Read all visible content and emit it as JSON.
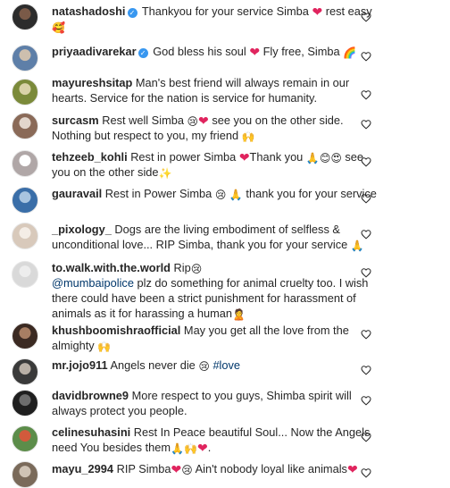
{
  "comments": [
    {
      "user": "natashadoshi",
      "verified": true,
      "segments": [
        {
          "t": "Thankyou for your service Simba "
        },
        {
          "e": "❤",
          "c": "heart"
        },
        {
          "t": " rest easy "
        },
        {
          "e": "🥰"
        }
      ],
      "avatar_colors": [
        "#2c2c2c",
        "#7a5a48"
      ]
    },
    {
      "user": "priyaadivarekar",
      "verified": true,
      "segments": [
        {
          "t": "God bless his soul "
        },
        {
          "e": "❤",
          "c": "heart"
        },
        {
          "t": " Fly free, Simba "
        },
        {
          "e": "🌈"
        }
      ],
      "avatar_colors": [
        "#5e7fa8",
        "#cdbfae"
      ]
    },
    {
      "user": "mayureshsitap",
      "verified": false,
      "segments": [
        {
          "t": "Man's best friend will always remain in our hearts. Service for the nation is service for humanity."
        }
      ],
      "avatar_colors": [
        "#7b8a3a",
        "#d9d2a8"
      ]
    },
    {
      "user": "surcasm",
      "verified": false,
      "segments": [
        {
          "t": "Rest well Simba "
        },
        {
          "e": "😢"
        },
        {
          "e": "❤",
          "c": "heart"
        },
        {
          "t": " see you on the other side. Nothing but respect to you, my friend "
        },
        {
          "e": "🙌"
        }
      ],
      "avatar_colors": [
        "#8a6a58",
        "#e2d6cc"
      ]
    },
    {
      "user": "tehzeeb_kohli",
      "verified": false,
      "segments": [
        {
          "t": "Rest in power Simba "
        },
        {
          "e": "❤",
          "c": "heart"
        },
        {
          "t": "Thank you "
        },
        {
          "e": "🙏"
        },
        {
          "e": "😊"
        },
        {
          "e": "😍"
        },
        {
          "t": " see you on the other side"
        },
        {
          "e": "✨"
        }
      ],
      "avatar_colors": [
        "#b0a7a7",
        "#ffffff"
      ]
    },
    {
      "user": "gauravail",
      "verified": false,
      "segments": [
        {
          "t": "Rest in Power Simba "
        },
        {
          "e": "😢"
        },
        {
          "t": " "
        },
        {
          "e": "🙏"
        },
        {
          "t": " thank you for your service"
        }
      ],
      "avatar_colors": [
        "#3a6ea8",
        "#a8c4e0"
      ]
    },
    {
      "user": "_pixology_",
      "verified": false,
      "segments": [
        {
          "t": "Dogs are the living embodiment of selfless & unconditional love... RIP Simba, thank you for your service "
        },
        {
          "e": "🙏"
        }
      ],
      "avatar_colors": [
        "#d8c9bb",
        "#f4ede6"
      ]
    },
    {
      "user": "to.walk.with.the.world",
      "verified": false,
      "segments": [
        {
          "t": "Rip"
        },
        {
          "e": "😢"
        },
        {
          "br": true
        },
        {
          "m": "@mumbaipolice"
        },
        {
          "t": " plz do something for animal cruelty too. I wish there could have been a strict punishment for harassment of animals as it for harassing a human"
        },
        {
          "e": "🙎"
        }
      ],
      "avatar_colors": [
        "#d9d9d9",
        "#ededed"
      ]
    },
    {
      "user": "khushboomishraofficial",
      "verified": false,
      "segments": [
        {
          "t": "May you get all the love from the almighty "
        },
        {
          "e": "🙌"
        }
      ],
      "avatar_colors": [
        "#3b2a22",
        "#a77e63"
      ]
    },
    {
      "user": "mr.jojo911",
      "verified": false,
      "segments": [
        {
          "t": "Angels never die "
        },
        {
          "e": "😢"
        },
        {
          "t": " "
        },
        {
          "h": "#love"
        }
      ],
      "avatar_colors": [
        "#3a3a3a",
        "#b9b0a6"
      ]
    },
    {
      "user": "davidbrowne9",
      "verified": false,
      "segments": [
        {
          "t": "More respect to you guys, Shimba spirit will always protect you people."
        }
      ],
      "avatar_colors": [
        "#1f1f1f",
        "#6d6d6d"
      ]
    },
    {
      "user": "celinesuhasini",
      "verified": false,
      "segments": [
        {
          "t": "Rest In Peace beautiful Soul... Now the Angels need You besides them"
        },
        {
          "e": "🙏"
        },
        {
          "e": "🙌"
        },
        {
          "e": "❤",
          "c": "heart"
        },
        {
          "t": "."
        }
      ],
      "avatar_colors": [
        "#5c8d4a",
        "#d25a3c"
      ]
    },
    {
      "user": "mayu_2994",
      "verified": false,
      "segments": [
        {
          "t": "RIP Simba"
        },
        {
          "e": "❤",
          "c": "heart"
        },
        {
          "e": "😢"
        },
        {
          "t": " Ain't nobody loyal like animals"
        },
        {
          "e": "❤",
          "c": "heart"
        }
      ],
      "avatar_colors": [
        "#7a6a5a",
        "#cfc3b5"
      ]
    }
  ]
}
